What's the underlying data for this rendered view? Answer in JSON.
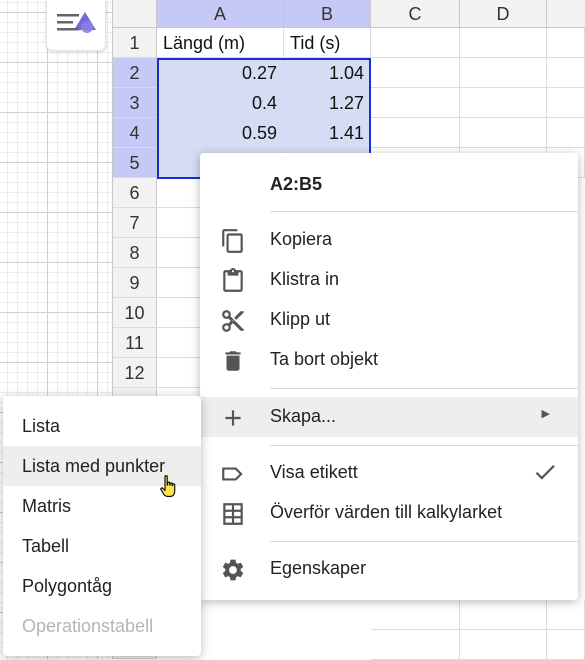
{
  "spreadsheet": {
    "columns": [
      "A",
      "B",
      "C",
      "D"
    ],
    "rows": [
      "1",
      "2",
      "3",
      "4",
      "5",
      "6",
      "7",
      "8",
      "9",
      "10",
      "11",
      "12"
    ],
    "headers": {
      "a1": "Längd (m)",
      "b1": "Tid (s)"
    },
    "data": [
      {
        "a": "0.27",
        "b": "1.04"
      },
      {
        "a": "0.4",
        "b": "1.27"
      },
      {
        "a": "0.59",
        "b": "1.41"
      }
    ]
  },
  "context_menu": {
    "title": "A2:B5",
    "items": [
      {
        "label": "Kopiera",
        "icon": "copy-icon"
      },
      {
        "label": "Klistra in",
        "icon": "paste-icon"
      },
      {
        "label": "Klipp ut",
        "icon": "cut-icon"
      },
      {
        "label": "Ta bort objekt",
        "icon": "delete-icon"
      },
      {
        "label": "Skapa...",
        "icon": "plus-icon"
      },
      {
        "label": "Visa etikett",
        "icon": "label-icon"
      },
      {
        "label": "Överför värden till kalkylarket",
        "icon": "table-icon"
      },
      {
        "label": "Egenskaper",
        "icon": "gear-icon"
      }
    ]
  },
  "create_submenu": {
    "items": [
      {
        "label": "Lista"
      },
      {
        "label": "Lista med punkter"
      },
      {
        "label": "Matris"
      },
      {
        "label": "Tabell"
      },
      {
        "label": "Polygontåg"
      },
      {
        "label": "Operationstabell"
      }
    ]
  },
  "colors": {
    "selection_border": "#1b2bd6",
    "selected_header": "#c6c8f6",
    "selected_cell": "#d6dcf4"
  }
}
